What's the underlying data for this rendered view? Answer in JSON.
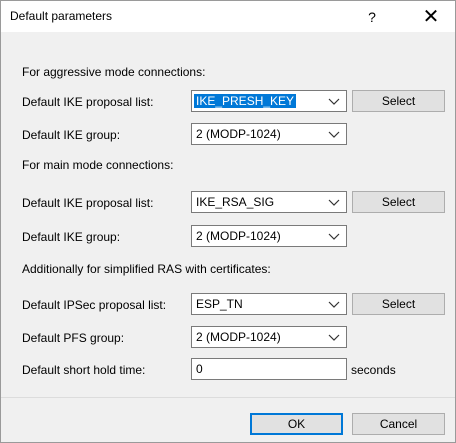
{
  "window": {
    "title": "Default parameters",
    "help_glyph": "?",
    "close_glyph": "✕"
  },
  "aggressive": {
    "heading": "For aggressive mode connections:",
    "ike_proposal_label": "Default IKE proposal list:",
    "ike_proposal_value": "IKE_PRESH_KEY",
    "ike_group_label": "Default IKE group:",
    "ike_group_value": "2 (MODP-1024)"
  },
  "main": {
    "heading": "For main mode connections:",
    "ike_proposal_label": "Default IKE proposal list:",
    "ike_proposal_value": "IKE_RSA_SIG",
    "ike_group_label": "Default IKE group:",
    "ike_group_value": "2 (MODP-1024)"
  },
  "ras": {
    "heading": "Additionally for simplified RAS with certificates:",
    "ipsec_proposal_label": "Default IPSec proposal list:",
    "ipsec_proposal_value": "ESP_TN",
    "pfs_group_label": "Default PFS group:",
    "pfs_group_value": "2 (MODP-1024)",
    "short_hold_label": "Default short hold time:",
    "short_hold_value": "0",
    "short_hold_unit": "seconds"
  },
  "buttons": {
    "select": "Select",
    "ok": "OK",
    "cancel": "Cancel"
  }
}
